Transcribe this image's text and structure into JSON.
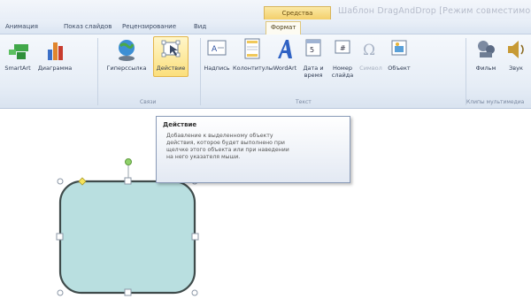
{
  "title": {
    "contextual_tab": "Средства рисования",
    "window_title": "Шаблон DragAndDrop [Режим совместимости]"
  },
  "tabs": [
    {
      "label": "Анимация"
    },
    {
      "label": "Показ слайдов"
    },
    {
      "label": "Рецензирование"
    },
    {
      "label": "Вид"
    },
    {
      "label": "Формат"
    }
  ],
  "ribbon": {
    "illustrations": [
      {
        "label": "SmartArt",
        "icon": "smartart-icon"
      },
      {
        "label": "Диаграмма",
        "icon": "chart-icon"
      }
    ],
    "links_group": {
      "label": "Связи",
      "buttons": [
        {
          "label": "Гиперссылка",
          "icon": "globe-link-icon"
        },
        {
          "label": "Действие",
          "icon": "action-icon",
          "state": "highlighted"
        }
      ]
    },
    "text_group": {
      "label": "Текст",
      "buttons": [
        {
          "label": "Надпись",
          "icon": "textbox-icon"
        },
        {
          "label": "Колонтитулы",
          "icon": "header-footer-icon"
        },
        {
          "label": "WordArt",
          "icon": "wordart-icon"
        },
        {
          "label": "Дата и",
          "label2": "время",
          "icon": "date-time-icon"
        },
        {
          "label": "Номер",
          "label2": "слайда",
          "icon": "slide-number-icon"
        },
        {
          "label": "Символ",
          "icon": "symbol-icon",
          "state": "disabled"
        },
        {
          "label": "Объект",
          "icon": "object-icon"
        }
      ]
    },
    "media_group": {
      "label": "Клипы мультимедиа",
      "buttons": [
        {
          "label": "Фильм",
          "icon": "film-icon"
        },
        {
          "label": "Звук",
          "icon": "sound-icon"
        }
      ]
    }
  },
  "tooltip": {
    "title": "Действие",
    "lines": [
      "Добавление к выделенному объекту",
      "действия, которое будет выполнено при",
      "щелчке этого объекта или при наведении",
      "на него указателя мыши."
    ]
  },
  "colors": {
    "shape_fill": "#b9dfe0",
    "shape_stroke": "#3f4b4b",
    "selection_handle": "#ffffff",
    "rotation_handle": "#8fd16a",
    "adjust_handle": "#f6e35a",
    "active_button": "#fbdf7d"
  }
}
